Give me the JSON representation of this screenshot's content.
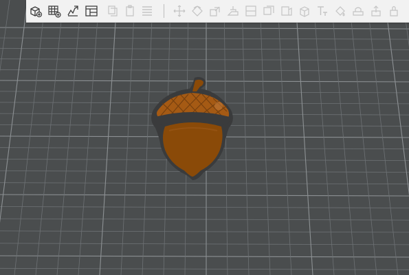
{
  "viewport": {
    "background_color": "#4a4d4e",
    "grid_line_color": "#6e7275",
    "grid_major_color": "#8c9093"
  },
  "toolbar": {
    "background_color": "#f2f2f2",
    "enabled_icon_color": "#3b3b3b",
    "disabled_icon_color": "#c4c4c4",
    "enabled_buttons": [
      "add-cube-icon",
      "add-grid-icon",
      "import-sketch-icon",
      "layout-panel-icon"
    ],
    "disabled_buttons": [
      "copy-icon",
      "paste-icon",
      "list-icon",
      "move-icon",
      "rotate-icon",
      "scale-icon",
      "align-icon",
      "group-icon",
      "ungroup-icon",
      "mirror-icon",
      "shell-icon",
      "text-icon",
      "paint-icon",
      "hole-icon",
      "export-icon"
    ]
  },
  "model": {
    "name": "acorn",
    "cap_color": "#a55a14",
    "body_color": "#8a4a08",
    "outline_color": "#3a3b3c"
  }
}
